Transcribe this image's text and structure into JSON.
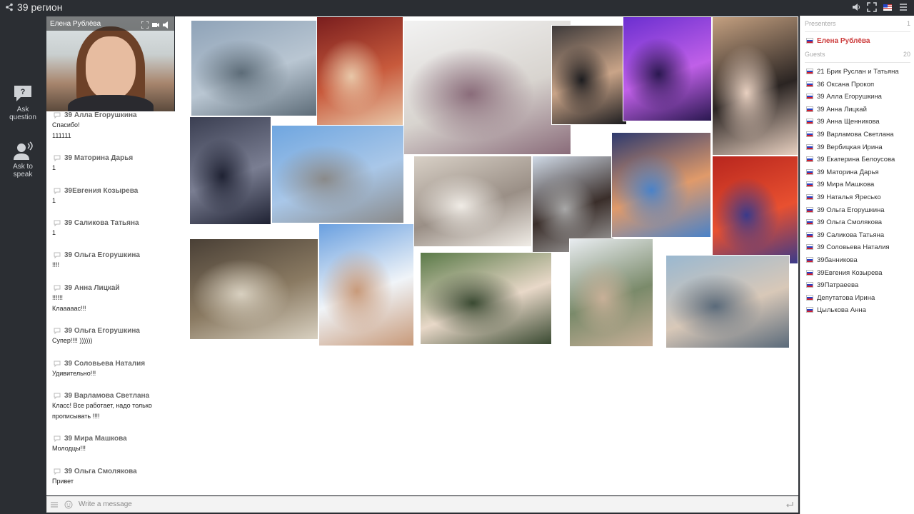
{
  "app": {
    "title": "39 регион"
  },
  "colors": {
    "background": "#2b2e33",
    "presenter": "#cc3b3b",
    "accent_flag_blue": "#2545c9",
    "accent_flag_red": "#d21f2f"
  },
  "rail": {
    "ask_question": [
      "Ask",
      "question"
    ],
    "ask_to_speak": [
      "Ask to",
      "speak"
    ]
  },
  "video": {
    "name": "Елена Рублёва"
  },
  "chat": {
    "messages": [
      {
        "author": "39 Алла Егорушкина",
        "lines": [
          "Спасибо!",
          "111111"
        ]
      },
      {
        "author": "39 Маторина Дарья",
        "lines": [
          "1"
        ]
      },
      {
        "author": "39Евгения Козырева",
        "lines": [
          "1"
        ]
      },
      {
        "author": "39 Саликова Татьяна",
        "lines": [
          "1"
        ]
      },
      {
        "author": "39 Ольга Егорушкина",
        "lines": [
          "!!!!"
        ]
      },
      {
        "author": "39 Анна Лицкай",
        "lines": [
          "!!!!!!",
          "Клааааас!!!"
        ]
      },
      {
        "author": "39 Ольга Егорушкина",
        "lines": [
          "Супер!!!! ))))))"
        ]
      },
      {
        "author": "39 Соловьева Наталия",
        "lines": [
          "Удивительно!!!"
        ]
      },
      {
        "author": "39 Варламова Светлана",
        "lines": [
          "Класс! Все работает, надо только",
          "прописывать !!!!"
        ]
      },
      {
        "author": "39 Мира Машкова",
        "lines": [
          "Молодцы!!!"
        ]
      },
      {
        "author": "39 Ольга Смолякова",
        "lines": [
          "Привет"
        ]
      }
    ],
    "composer_placeholder": "Write a message"
  },
  "panel": {
    "presenters_label": "Presenters",
    "presenters_count": "1",
    "presenter": "Елена Рублёва",
    "guests_label": "Guests",
    "guests_count": "20",
    "guests": [
      "21 Брик Руслан и Татьяна",
      "36 Оксана Прокоп",
      "39 Алла Егорушкина",
      "39 Анна Лицкай",
      "39 Анна Щенникова",
      "39 Варламова Светлана",
      "39 Вербицкая Ирина",
      "39 Екатерина Белоусова",
      "39 Маторина Дарья",
      "39 Мира Машкова",
      "39 Наталья Яресько",
      "39 Ольга Егорушкина",
      "39 Ольга Смолякова",
      "39 Саликова Татьяна",
      "39 Соловьева Наталия",
      "39банникова",
      "39Евгения Козырева",
      "39Патраеева",
      "Депутатова Ирина",
      "Цылькова Анна"
    ]
  },
  "stage": {
    "photos": [
      {
        "name": "photo-tokyo-tower-couple",
        "colors": [
          "#8fa3b8",
          "#b9c6d2",
          "#5d6c78"
        ]
      },
      {
        "name": "photo-sumo-wrestlers",
        "colors": [
          "#7a1e1e",
          "#c85a3c",
          "#e8c7a8"
        ]
      },
      {
        "name": "photo-geisha-group",
        "colors": [
          "#f2f2f2",
          "#d8d4cf",
          "#8a6c7a"
        ]
      },
      {
        "name": "photo-couple-selfie-dark",
        "colors": [
          "#3e3a3a",
          "#c9a488",
          "#1c1c1f"
        ]
      },
      {
        "name": "photo-purple-selfie",
        "colors": [
          "#6b2fd0",
          "#c060e8",
          "#2a1850"
        ]
      },
      {
        "name": "photo-gala-trio",
        "colors": [
          "#c4a080",
          "#2a2422",
          "#e8d0c0"
        ]
      },
      {
        "name": "photo-night-street",
        "colors": [
          "#3b3f52",
          "#7a7e92",
          "#1f2233"
        ]
      },
      {
        "name": "photo-jumping-pair",
        "colors": [
          "#6fa6e0",
          "#a9c7e8",
          "#8a8a8a"
        ]
      },
      {
        "name": "photo-doctor-clinic",
        "colors": [
          "#d8d0c6",
          "#9a8f86",
          "#f0ece6"
        ]
      },
      {
        "name": "photo-japanese-temple",
        "colors": [
          "#cfd9e6",
          "#3a2e2a",
          "#a8a8a8"
        ]
      },
      {
        "name": "photo-stage-couple",
        "colors": [
          "#2e3a6e",
          "#e09a6a",
          "#4a82c8"
        ]
      },
      {
        "name": "photo-red-lanterns",
        "colors": [
          "#b8261e",
          "#e85030",
          "#3a3a8a"
        ]
      },
      {
        "name": "photo-torii-gate",
        "colors": [
          "#4a4036",
          "#8a7a62",
          "#d8d0c0"
        ]
      },
      {
        "name": "photo-mount-fuji-selfie",
        "colors": [
          "#6aa0e0",
          "#f0f4f8",
          "#c89a7a"
        ]
      },
      {
        "name": "photo-restaurant-group",
        "colors": [
          "#5a7a48",
          "#e8d8c8",
          "#3a4a32"
        ]
      },
      {
        "name": "photo-blossom-selfie",
        "colors": [
          "#e8ecf0",
          "#7a8a6a",
          "#c8b098"
        ]
      },
      {
        "name": "photo-lake-group",
        "colors": [
          "#9ab8d0",
          "#d8c8b8",
          "#5a6a7a"
        ]
      }
    ]
  }
}
